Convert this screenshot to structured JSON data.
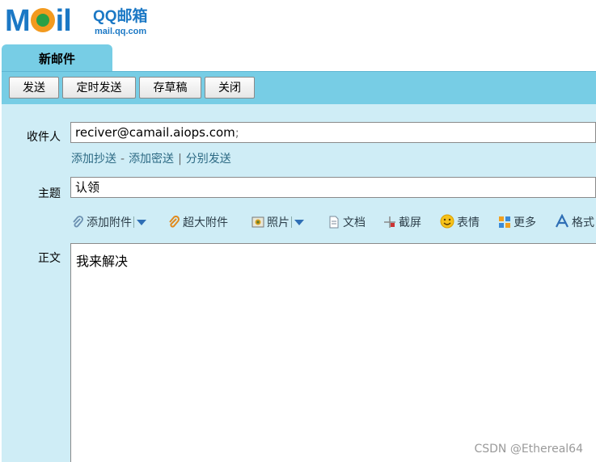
{
  "logo": {
    "brand_m": "M",
    "brand_il": "il",
    "qq_text": "QQ邮箱",
    "domain": "mail.qq.com"
  },
  "tab": {
    "label": "新邮件"
  },
  "toolbar": {
    "send": "发送",
    "scheduled_send": "定时发送",
    "save_draft": "存草稿",
    "close": "关闭"
  },
  "compose": {
    "recipient_label": "收件人",
    "recipient_value": "reciver@camail.aiops.com",
    "recipient_suffix": ";",
    "links": {
      "add_cc": "添加抄送",
      "dash": "-",
      "add_bcc": "添加密送",
      "bar": "|",
      "separate_send": "分别发送"
    },
    "subject_label": "主题",
    "subject_value": "认领",
    "attach_toolbar": {
      "add_attachment": "添加附件",
      "large_attachment": "超大附件",
      "photo": "照片",
      "document": "文档",
      "screenshot": "截屏",
      "emoji": "表情",
      "more": "更多",
      "format": "格式"
    },
    "body_label": "正文",
    "body_value": "我来解决"
  },
  "watermark": "CSDN @Ethereal64",
  "colors": {
    "header_blue": "#77cde5",
    "compose_bg": "#cfedf6",
    "link_color": "#2d6a84",
    "logo_blue": "#1b78c5"
  }
}
